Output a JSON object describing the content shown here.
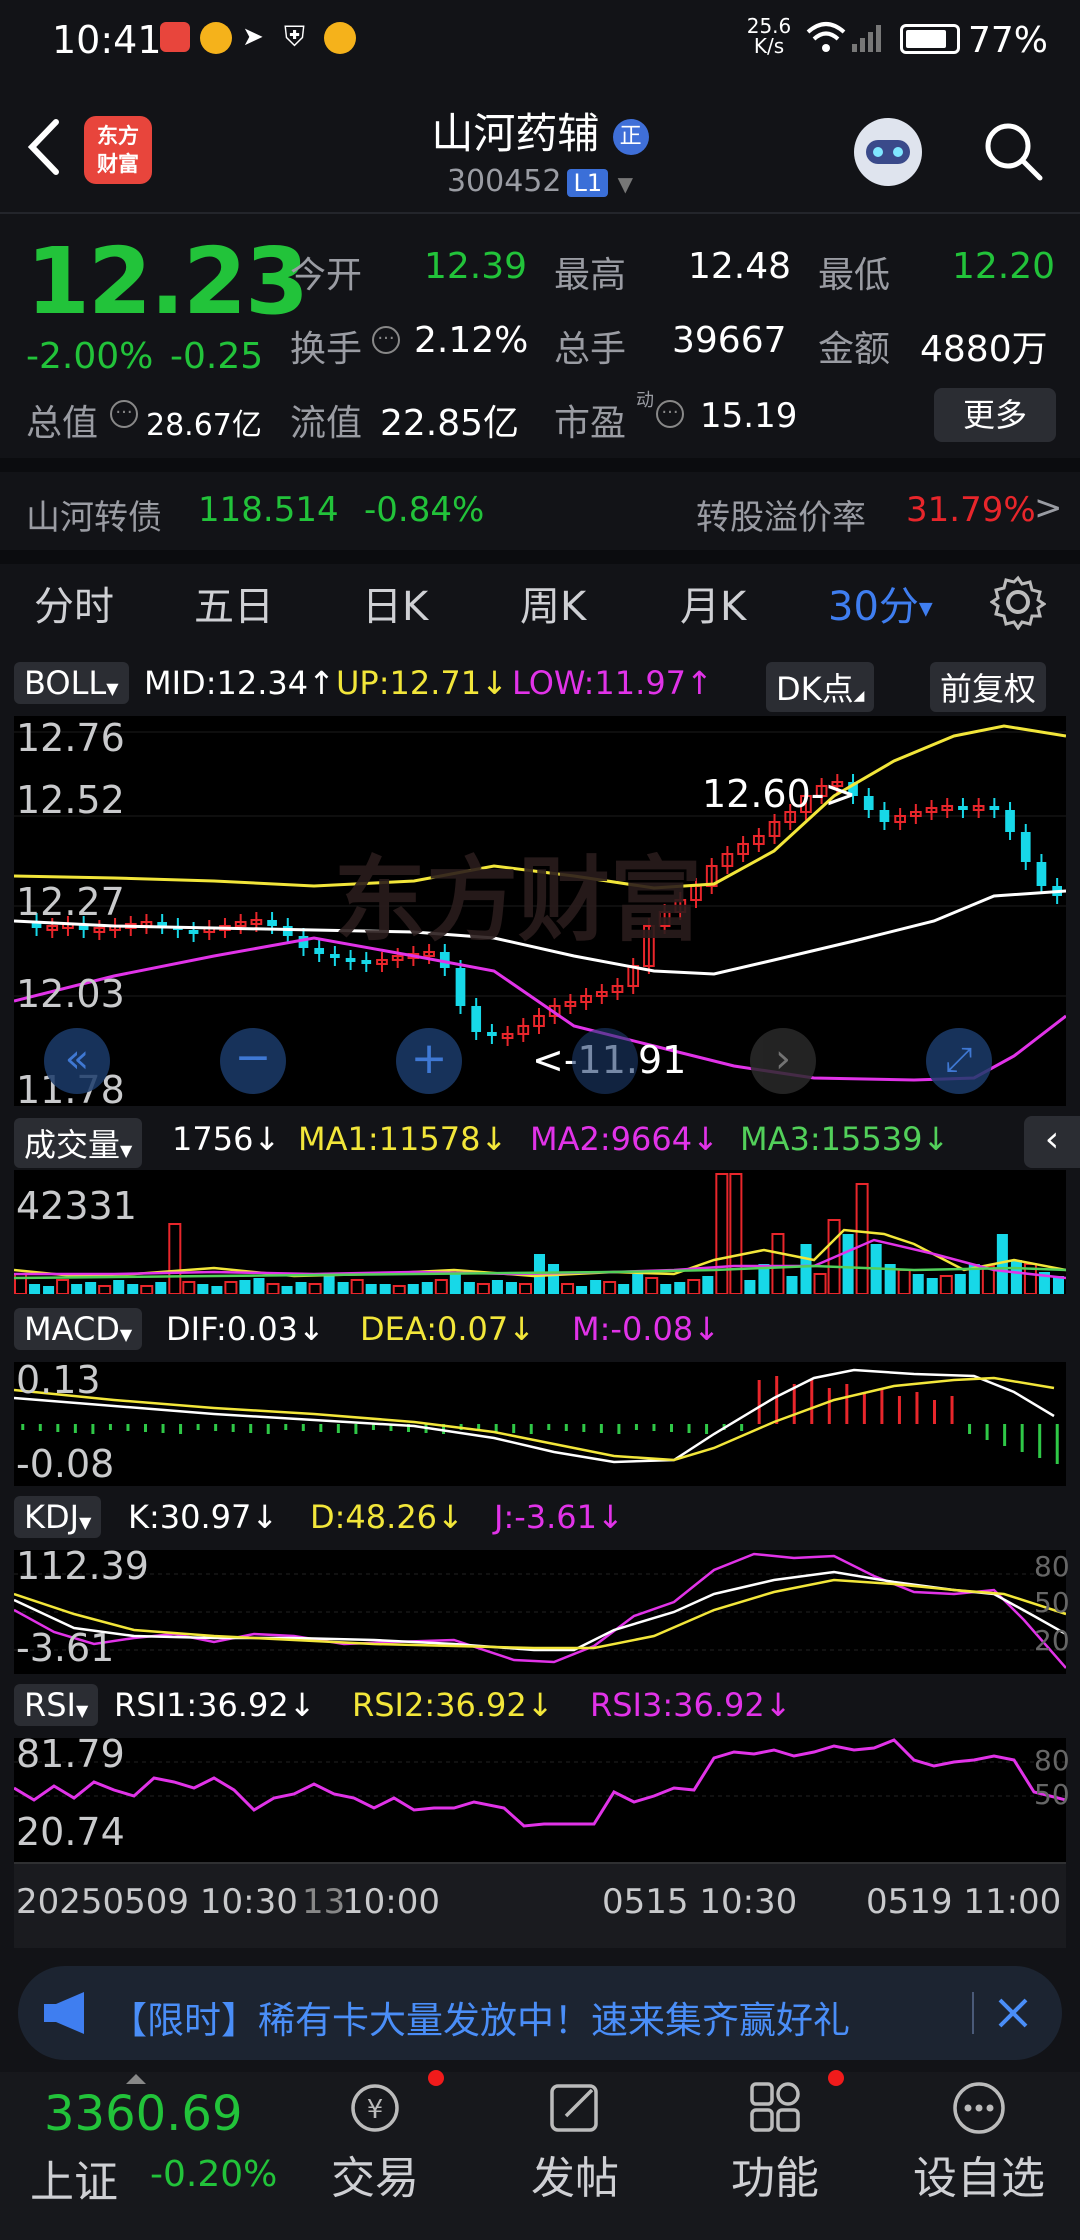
{
  "status_bar": {
    "time": "10:41",
    "net_speed_value": "25.6",
    "net_speed_unit": "K/s",
    "battery": "77%"
  },
  "header": {
    "logo_line1": "东方",
    "logo_line2": "财富",
    "stock_name": "山河药辅",
    "badge": "正",
    "stock_code": "300452",
    "level": "L1"
  },
  "quote": {
    "price": "12.23",
    "change_pct": "-2.00%",
    "change_amt": "-0.25",
    "open_label": "今开",
    "open": "12.39",
    "high_label": "最高",
    "high": "12.48",
    "low_label": "最低",
    "low": "12.20",
    "turnover_label": "换手",
    "turnover": "2.12%",
    "volume_label": "总手",
    "volume": "39667",
    "amount_label": "金额",
    "amount": "4880万",
    "mktcap_label": "总值",
    "mktcap": "28.67亿",
    "float_label": "流值",
    "float": "22.85亿",
    "pe_label": "市盈",
    "pe_sup": "动",
    "pe": "15.19",
    "more": "更多"
  },
  "bond": {
    "name": "山河转债",
    "price": "118.514",
    "change": "-0.84%",
    "premium_label": "转股溢价率",
    "premium": "31.79%",
    "arrow": ">"
  },
  "tabs": [
    "分时",
    "五日",
    "日K",
    "周K",
    "月K",
    "30分"
  ],
  "boll": {
    "name": "BOLL",
    "mid": "MID:12.34↑",
    "up": "UP:12.71↓",
    "low": "LOW:11.97↑",
    "dk": "DK点",
    "fq": "前复权",
    "y_labels": [
      "12.76",
      "12.52",
      "12.27",
      "12.03",
      "11.78"
    ],
    "annot_high": "12.60->",
    "annot_low": "<-11.91",
    "watermark": "东方财富"
  },
  "volume": {
    "name": "成交量",
    "value": "1756↓",
    "ma1": "MA1:11578↓",
    "ma2": "MA2:9664↓",
    "ma3": "MA3:15539↓",
    "y_label": "42331"
  },
  "macd": {
    "name": "MACD",
    "dif": "DIF:0.03↓",
    "dea": "DEA:0.07↓",
    "m": "M:-0.08↓",
    "y_top": "0.13",
    "y_bottom": "-0.08"
  },
  "kdj": {
    "name": "KDJ",
    "k": "K:30.97↓",
    "d": "D:48.26↓",
    "j": "J:-3.61↓",
    "y_top": "112.39",
    "y_bottom": "-3.61",
    "r_80": "80",
    "r_50": "50",
    "r_20": "20"
  },
  "rsi": {
    "name": "RSI",
    "rsi1": "RSI1:36.92↓",
    "rsi2": "RSI2:36.92↓",
    "rsi3": "RSI3:36.92↓",
    "y_top": "81.79",
    "y_bottom": "20.74",
    "r_80": "80",
    "r_50": "50"
  },
  "x_axis": {
    "t1": "20250509 10:30",
    "t1_tail": "13",
    "t2": "10:00",
    "t3": "0515 10:30",
    "t4": "0519 11:00"
  },
  "banner": {
    "text": "【限时】稀有卡大量发放中！速来集齐赢好礼"
  },
  "bottom": {
    "index_value": "3360.69",
    "index_name": "上证",
    "index_change": "-0.20%",
    "nav": [
      "交易",
      "发帖",
      "功能",
      "设自选"
    ]
  },
  "colors": {
    "up": "#e8262b",
    "down": "#22c33a",
    "accent": "#3f7ef0",
    "mid_line": "#ffffff",
    "up_line": "#f2e63a",
    "low_line": "#e133e8"
  }
}
